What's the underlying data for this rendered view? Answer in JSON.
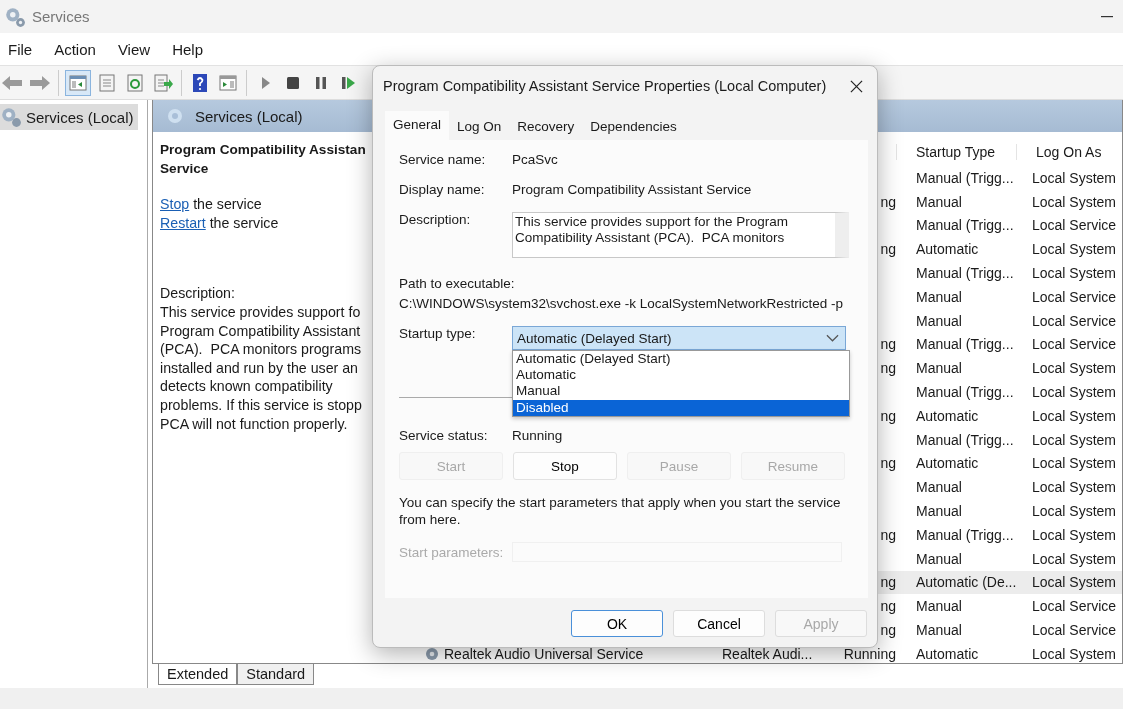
{
  "window": {
    "title": "Services"
  },
  "menu": [
    "File",
    "Action",
    "View",
    "Help"
  ],
  "tree": {
    "items": [
      {
        "label": "Services (Local)",
        "selected": true
      }
    ]
  },
  "pane_header": "Services (Local)",
  "details": {
    "title_lines": [
      "Program Compatibility Assistan",
      "Service"
    ],
    "actions": [
      {
        "link": "Stop",
        "rest": " the service"
      },
      {
        "link": "Restart",
        "rest": " the service"
      }
    ],
    "description_label": "Description:",
    "description_lines": [
      "This service provides support fo",
      "Program Compatibility Assistant",
      "(PCA).  PCA monitors programs",
      "installed and run by the user an",
      "detects known compatibility",
      "problems. If this service is stopp",
      "PCA will not function properly."
    ]
  },
  "table": {
    "columns": [
      "Startup Type",
      "Log On As"
    ],
    "rows": [
      {
        "status": "",
        "startup_type": "Manual (Trigg...",
        "log_on_as": "Local System",
        "selected": false
      },
      {
        "status": "ng",
        "startup_type": "Manual",
        "log_on_as": "Local System",
        "selected": false
      },
      {
        "status": "",
        "startup_type": "Manual (Trigg...",
        "log_on_as": "Local Service",
        "selected": false
      },
      {
        "status": "ng",
        "startup_type": "Automatic",
        "log_on_as": "Local System",
        "selected": false
      },
      {
        "status": "",
        "startup_type": "Manual (Trigg...",
        "log_on_as": "Local System",
        "selected": false
      },
      {
        "status": "",
        "startup_type": "Manual",
        "log_on_as": "Local Service",
        "selected": false
      },
      {
        "status": "",
        "startup_type": "Manual",
        "log_on_as": "Local Service",
        "selected": false
      },
      {
        "status": "ng",
        "startup_type": "Manual (Trigg...",
        "log_on_as": "Local Service",
        "selected": false
      },
      {
        "status": "ng",
        "startup_type": "Manual",
        "log_on_as": "Local System",
        "selected": false
      },
      {
        "status": "",
        "startup_type": "Manual (Trigg...",
        "log_on_as": "Local System",
        "selected": false
      },
      {
        "status": "ng",
        "startup_type": "Automatic",
        "log_on_as": "Local System",
        "selected": false
      },
      {
        "status": "",
        "startup_type": "Manual (Trigg...",
        "log_on_as": "Local System",
        "selected": false
      },
      {
        "status": "ng",
        "startup_type": "Automatic",
        "log_on_as": "Local System",
        "selected": false
      },
      {
        "status": "",
        "startup_type": "Manual",
        "log_on_as": "Local System",
        "selected": false
      },
      {
        "status": "",
        "startup_type": "Manual",
        "log_on_as": "Local System",
        "selected": false
      },
      {
        "status": "ng",
        "startup_type": "Manual (Trigg...",
        "log_on_as": "Local System",
        "selected": false
      },
      {
        "status": "",
        "startup_type": "Manual",
        "log_on_as": "Local System",
        "selected": false
      },
      {
        "status": "ng",
        "startup_type": "Automatic (De...",
        "log_on_as": "Local System",
        "selected": true
      },
      {
        "status": "ng",
        "startup_type": "Manual",
        "log_on_as": "Local Service",
        "selected": false
      },
      {
        "status": "ng",
        "startup_type": "Manual",
        "log_on_as": "Local Service",
        "selected": false
      },
      {
        "name": "Realtek Audio Universal Service",
        "description": "Realtek Audi...",
        "status": "Running",
        "startup_type": "Automatic",
        "log_on_as": "Local System",
        "selected": false
      }
    ]
  },
  "view_tabs": [
    {
      "label": "Extended",
      "selected": true
    },
    {
      "label": "Standard",
      "selected": false
    }
  ],
  "dialog": {
    "title": "Program Compatibility Assistant Service Properties (Local Computer)",
    "tabs": [
      {
        "label": "General",
        "selected": true
      },
      {
        "label": "Log On",
        "selected": false
      },
      {
        "label": "Recovery",
        "selected": false
      },
      {
        "label": "Dependencies",
        "selected": false
      }
    ],
    "service_name_label": "Service name:",
    "service_name": "PcaSvc",
    "display_name_label": "Display name:",
    "display_name": "Program Compatibility Assistant Service",
    "description_label": "Description:",
    "description_lines": [
      "This service provides support for the Program",
      "Compatibility Assistant (PCA).  PCA monitors"
    ],
    "path_label": "Path to executable:",
    "path": "C:\\WINDOWS\\system32\\svchost.exe -k LocalSystemNetworkRestricted -p",
    "startup_label": "Startup type:",
    "startup_value": "Automatic (Delayed Start)",
    "startup_options": [
      {
        "label": "Automatic (Delayed Start)",
        "selected": false
      },
      {
        "label": "Automatic",
        "selected": false
      },
      {
        "label": "Manual",
        "selected": false
      },
      {
        "label": "Disabled",
        "selected": true
      }
    ],
    "status_label": "Service status:",
    "status": "Running",
    "control_buttons": [
      {
        "label": "Start",
        "disabled": true
      },
      {
        "label": "Stop",
        "disabled": false
      },
      {
        "label": "Pause",
        "disabled": true
      },
      {
        "label": "Resume",
        "disabled": true
      }
    ],
    "hint": "You can specify the start parameters that apply when you start the service from here.",
    "params_label": "Start parameters:",
    "params_disabled": true,
    "buttons": [
      {
        "label": "OK",
        "disabled": false,
        "default": true
      },
      {
        "label": "Cancel",
        "disabled": false,
        "default": false
      },
      {
        "label": "Apply",
        "disabled": true,
        "default": false
      }
    ]
  }
}
